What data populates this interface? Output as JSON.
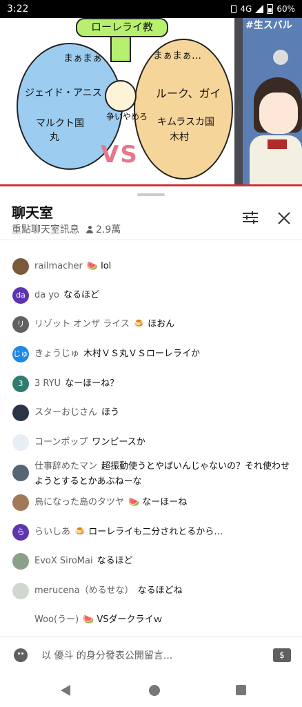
{
  "status_bar": {
    "time": "3:22",
    "network": "4G",
    "battery": "60%"
  },
  "video": {
    "whiteboard": {
      "top_label": "ローレライ教",
      "left_top": "まぁまぁ",
      "right_top": "まぁまぁ…",
      "left_mid": "ジェイド・アニス",
      "right_mid": "ルーク、ガイ",
      "left_bottom": "マルクト国",
      "left_bottom2": "丸",
      "right_bottom": "キムラスカ国",
      "right_bottom2": "木村",
      "center": "争いやめろ",
      "vs": "VS"
    },
    "channel_tag": "#生スバル"
  },
  "chat": {
    "title": "聊天室",
    "subtitle": "重點聊天室訊息",
    "viewers": "2.9萬",
    "messages": [
      {
        "author": "railmacher",
        "badge": "🍉",
        "text": "lol",
        "avatar_text": "",
        "avatar_color": "#7a5a3a"
      },
      {
        "author": "da yo",
        "badge": "",
        "text": "なるほど",
        "avatar_text": "da",
        "avatar_color": "#5e35b1"
      },
      {
        "author": "リゾット オンザ ライス",
        "badge": "🍮",
        "text": "ほおん",
        "avatar_text": "リ",
        "avatar_color": "#616161"
      },
      {
        "author": "きょうじゅ",
        "badge": "",
        "text": "木村ＶＳ丸ＶＳローレライか",
        "avatar_text": "じゅ",
        "avatar_color": "#1e88e5"
      },
      {
        "author": "3 RYU",
        "badge": "",
        "text": "なーほーね？",
        "avatar_text": "3",
        "avatar_color": "#2e7d6e"
      },
      {
        "author": "スターおじさん",
        "badge": "",
        "text": "ほう",
        "avatar_text": "",
        "avatar_color": "#2b3445"
      },
      {
        "author": "コーンポップ",
        "badge": "",
        "text": "ワンピースか",
        "avatar_text": "",
        "avatar_color": "#e8eef5"
      },
      {
        "author": "仕事辞めたマン",
        "badge": "",
        "text": "超振動使うとやばいんじゃないの？それ使わせようとするとかあぶねーな",
        "avatar_text": "",
        "avatar_color": "#556677"
      },
      {
        "author": "鳥になった島のタツヤ",
        "badge": "🍉",
        "text": "なーほーね",
        "avatar_text": "",
        "avatar_color": "#a0785a"
      },
      {
        "author": "らいしあ",
        "badge": "🍮",
        "text": "ローレライも二分されとるから…",
        "avatar_text": "ら",
        "avatar_color": "#5e35b1"
      },
      {
        "author": "EvoX SiroMai",
        "badge": "",
        "text": "なるほど",
        "avatar_text": "",
        "avatar_color": "#8aa08a"
      },
      {
        "author": "merucena（めるせな）",
        "badge": "",
        "text": "なるほどね",
        "avatar_text": "",
        "avatar_color": "#cfd8cf"
      },
      {
        "author": "Woo(うー)",
        "badge": "🍉",
        "text": "VSダークライｗ",
        "avatar_text": "",
        "avatar_color": "#ffffff"
      }
    ],
    "input_placeholder": "以 優斗 的身分發表公開留言...",
    "money_icon": "$"
  }
}
